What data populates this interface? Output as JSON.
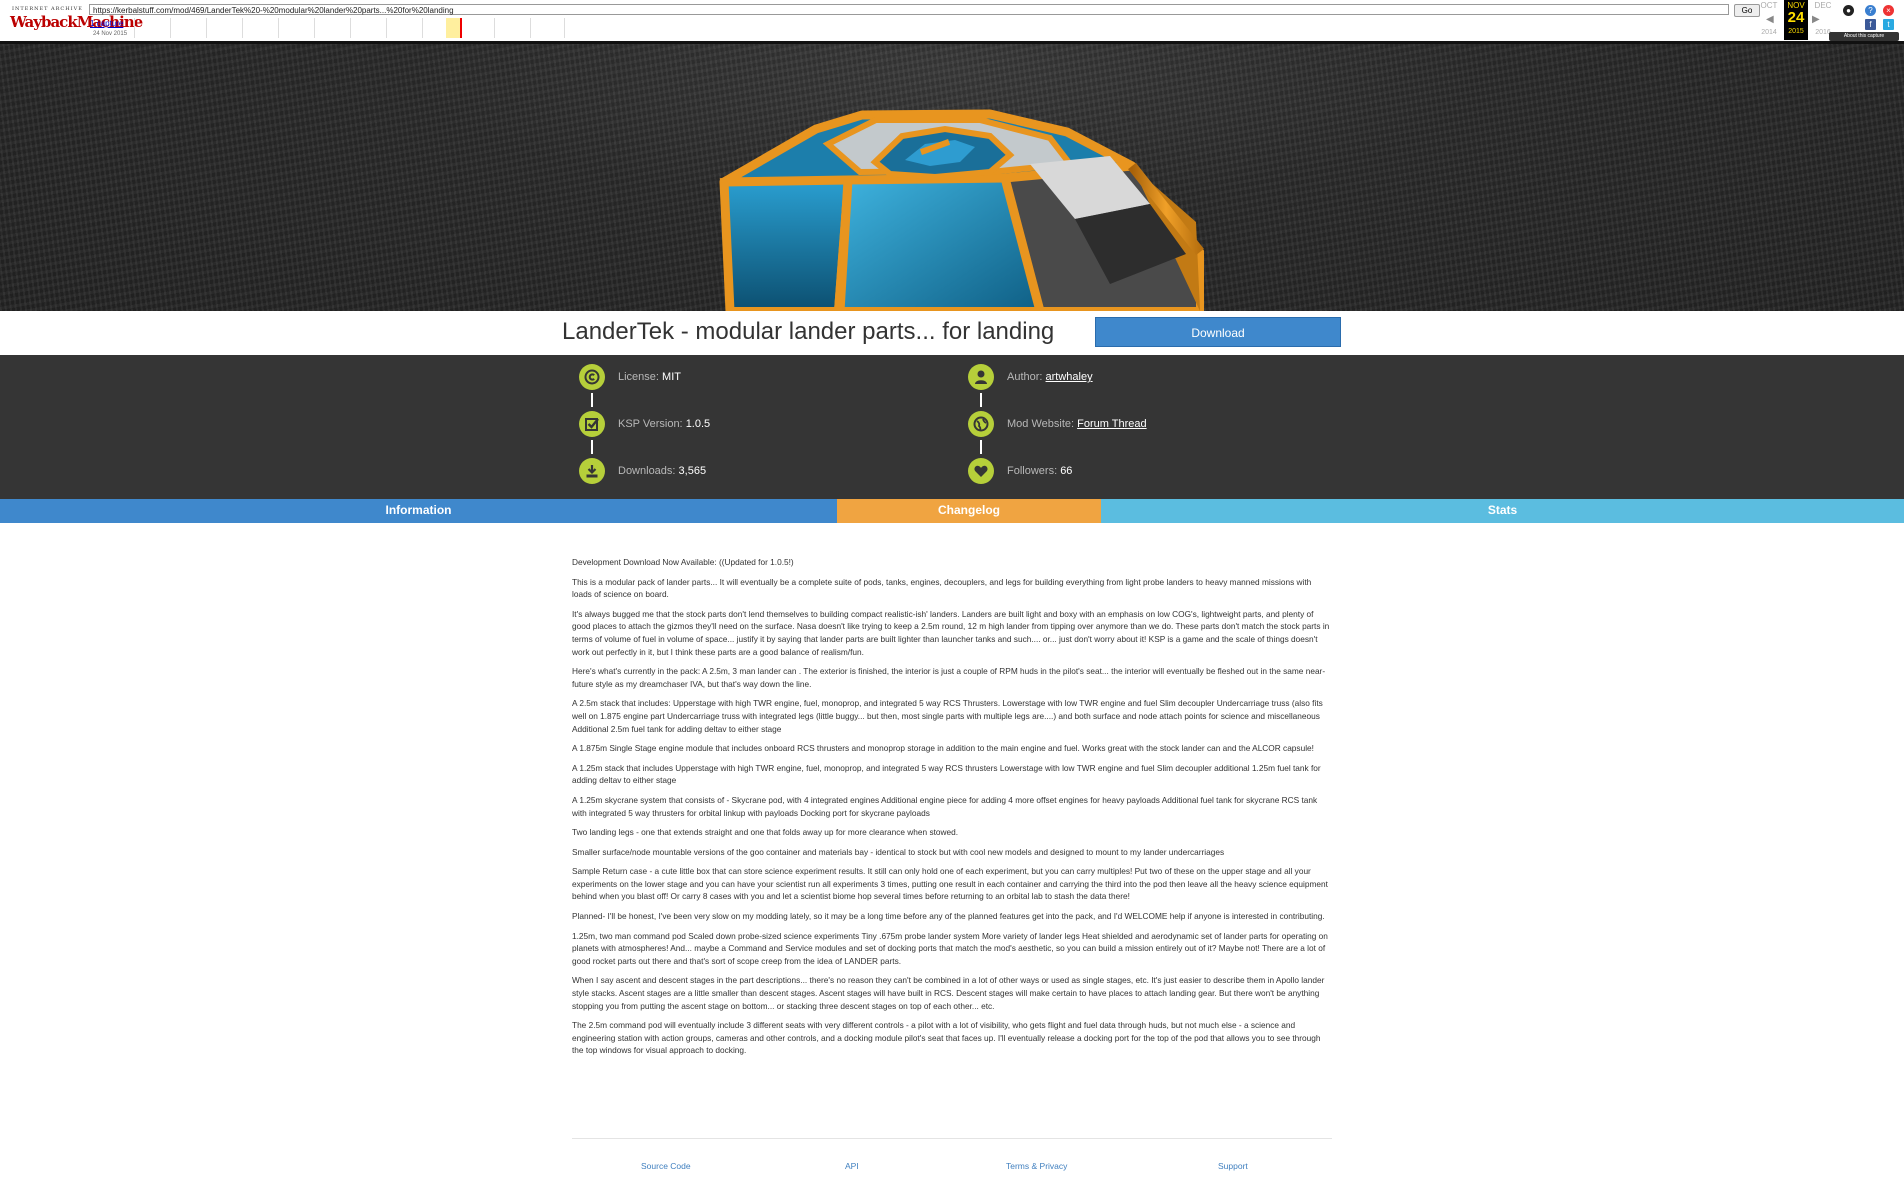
{
  "wayback": {
    "ia_label": "INTERNET ARCHIVE",
    "logo_text": "WaybackMachine",
    "url": "https://kerbalstuff.com/mod/469/LanderTek%20-%20modular%20lander%20parts...%20for%20landing",
    "go_label": "Go",
    "captures_label": "1 capture",
    "capture_date": "24 Nov 2015",
    "calendar": {
      "prev_month": "OCT",
      "prev_year": "2014",
      "cur_month": "NOV",
      "cur_day": "24",
      "cur_year": "2015",
      "next_month": "DEC",
      "next_year": "2016"
    },
    "about_label": "About this capture"
  },
  "mod": {
    "title": "LanderTek - modular lander parts... for landing",
    "download_label": "Download"
  },
  "meta": {
    "license_label": "License:",
    "license_value": "MIT",
    "ksp_label": "KSP Version:",
    "ksp_value": "1.0.5",
    "downloads_label": "Downloads:",
    "downloads_value": "3,565",
    "author_label": "Author:",
    "author_value": "artwhaley",
    "website_label": "Mod Website:",
    "website_value": "Forum Thread",
    "followers_label": "Followers:",
    "followers_value": "66"
  },
  "tabs": [
    {
      "label": "Information",
      "color": "#3f88cc"
    },
    {
      "label": "Changelog",
      "color": "#f0a441"
    },
    {
      "label": "Stats",
      "color": "#5bbde0"
    }
  ],
  "description": [
    "Development Download Now Available: ((Updated for 1.0.5!)",
    "This is a modular pack of lander parts... It will eventually be a complete suite of pods, tanks, engines, decouplers, and legs for building everything from light probe landers to heavy manned missions with loads of science on board.",
    "It's always bugged me that the stock parts don't lend themselves to building compact realistic-ish' landers. Landers are built light and boxy with an emphasis on low COG's, lightweight parts, and plenty of good places to attach the gizmos they'll need on the surface. Nasa doesn't like trying to keep a 2.5m round, 12 m high lander from tipping over anymore than we do. These parts don't match the stock parts in terms of volume of fuel in volume of space... justify it by saying that lander parts are built lighter than launcher tanks and such.... or... just don't worry about it! KSP is a game and the scale of things doesn't work out perfectly in it, but I think these parts are a good balance of realism/fun.",
    "Here's what's currently in the pack: A 2.5m, 3 man lander can . The exterior is finished, the interior is just a couple of RPM huds in the pilot's seat... the interior will eventually be fleshed out in the same near-future style as my dreamchaser IVA, but that's way down the line.",
    "A 2.5m stack that includes: Upperstage with high TWR engine, fuel, monoprop, and integrated 5 way RCS Thrusters. Lowerstage with low TWR engine and fuel Slim decoupler Undercarriage truss (also fits well on 1.875 engine part Undercarriage truss with integrated legs (little buggy... but then, most single parts with multiple legs are....) and both surface and node attach points for science and miscellaneous Additional 2.5m fuel tank for adding deltav to either stage",
    "A 1.875m Single Stage engine module that includes onboard RCS thrusters and monoprop storage in addition to the main engine and fuel. Works great with the stock lander can and the ALCOR capsule!",
    "A 1.25m stack that includes Upperstage with high TWR engine, fuel, monoprop, and integrated 5 way RCS thrusters Lowerstage with low TWR engine and fuel Slim decoupler additional 1.25m fuel tank for adding deltav to either stage",
    "A 1.25m skycrane system that consists of - Skycrane pod, with 4 integrated engines Additional engine piece for adding 4 more offset engines for heavy payloads Additional fuel tank for skycrane RCS tank with integrated 5 way thrusters for orbital linkup with payloads Docking port for skycrane payloads",
    "Two landing legs - one that extends straight and one that folds away up for more clearance when stowed.",
    "Smaller surface/node mountable versions of the goo container and materials bay - identical to stock but with cool new models and designed to mount to my lander undercarriages",
    "Sample Return case - a cute little box that can store science experiment results. It still can only hold one of each experiment, but you can carry multiples! Put two of these on the upper stage and all your experiments on the lower stage and you can have your scientist run all experiments 3 times, putting one result in each container and carrying the third into the pod then leave all the heavy science equipment behind when you blast off! Or carry 8 cases with you and let a scientist biome hop several times before returning to an orbital lab to stash the data there!",
    "Planned- I'll be honest, I've been very slow on my modding lately, so it may be a long time before any of the planned features get into the pack, and I'd WELCOME help if anyone is interested in contributing.",
    "1.25m, two man command pod Scaled down probe-sized science experiments Tiny .675m probe lander system More variety of lander legs Heat shielded and aerodynamic set of lander parts for operating on planets with atmospheres! And... maybe a Command and Service modules and set of docking ports that match the mod's aesthetic, so you can build a mission entirely out of it? Maybe not! There are a lot of good rocket parts out there and that's sort of scope creep from the idea of LANDER parts.",
    "When I say ascent and descent stages in the part descriptions... there's no reason they can't be combined in a lot of other ways or used as single stages, etc. It's just easier to describe them in Apollo lander style stacks. Ascent stages are a little smaller than descent stages. Ascent stages will have built in RCS. Descent stages will make certain to have places to attach landing gear. But there won't be anything stopping you from putting the ascent stage on bottom... or stacking three descent stages on top of each other... etc.",
    "The 2.5m command pod will eventually include 3 different seats with very different controls - a pilot with a lot of visibility, who gets flight and fuel data through huds, but not much else - a science and engineering station with action groups, cameras and other controls, and a docking module pilot's seat that faces up. I'll eventually release a docking port for the top of the pod that allows you to see through the top windows for visual approach to docking."
  ],
  "footer": {
    "source": "Source Code",
    "api": "API",
    "terms": "Terms & Privacy",
    "support": "Support"
  },
  "colors": {
    "accent_green": "#b6cf3a",
    "lander_orange": "#e8951f",
    "lander_blue": "#1f8fc0"
  }
}
